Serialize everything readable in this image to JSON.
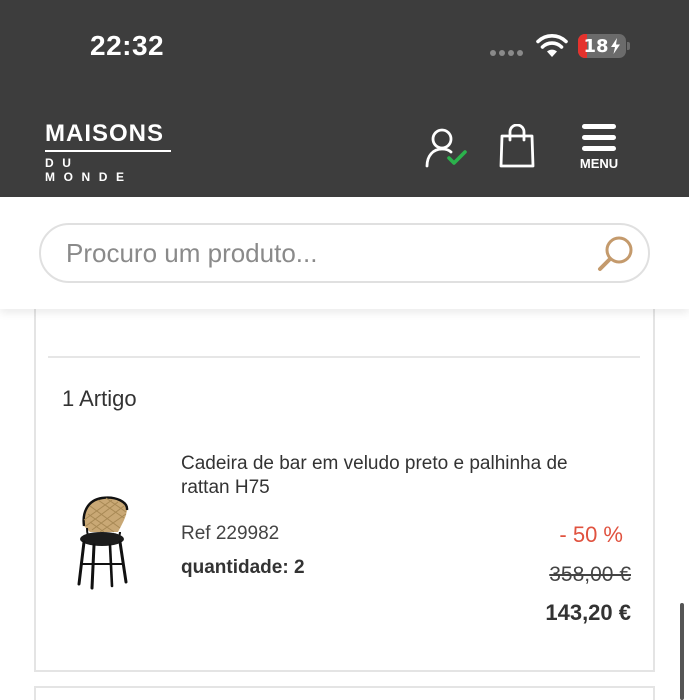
{
  "status_bar": {
    "time": "22:32",
    "battery": "18",
    "battery_level": 0.18,
    "battery_color": "#e5322d"
  },
  "header": {
    "logo_top": "MAISONS",
    "logo_bottom": "DU MONDE",
    "account_icon": "user-check-icon",
    "bag_icon": "shopping-bag-icon",
    "menu_label": "MENU",
    "background": "#3d3d3d"
  },
  "search": {
    "placeholder": "Procuro um produto...",
    "value": "",
    "icon": "search-icon",
    "icon_color": "#c49a6c"
  },
  "order": {
    "items_title": "1 Artigo",
    "item": {
      "name": "Cadeira de bar em veludo preto e palhinha de rattan H75",
      "ref": "Ref 229982",
      "quantity": "quantidade: 2",
      "discount": "- 50 %",
      "old_price": "358,00 €",
      "price": "143,20 €",
      "image": "bar-chair-image",
      "discount_color": "#e0523f"
    }
  }
}
